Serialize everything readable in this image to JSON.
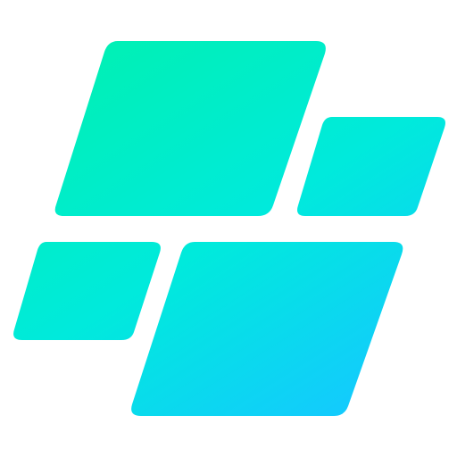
{
  "logo": {
    "icon_name": "four-slanted-tiles-logo-icon",
    "background_color": "#ffffff",
    "gradient": {
      "start_color": "#00f0b5",
      "mid_color": "#00eadc",
      "end_color": "#14c9ff"
    },
    "tiles": [
      {
        "name": "large-top-left-tile"
      },
      {
        "name": "small-top-right-tile"
      },
      {
        "name": "small-bottom-left-tile"
      },
      {
        "name": "large-bottom-right-tile"
      }
    ]
  }
}
